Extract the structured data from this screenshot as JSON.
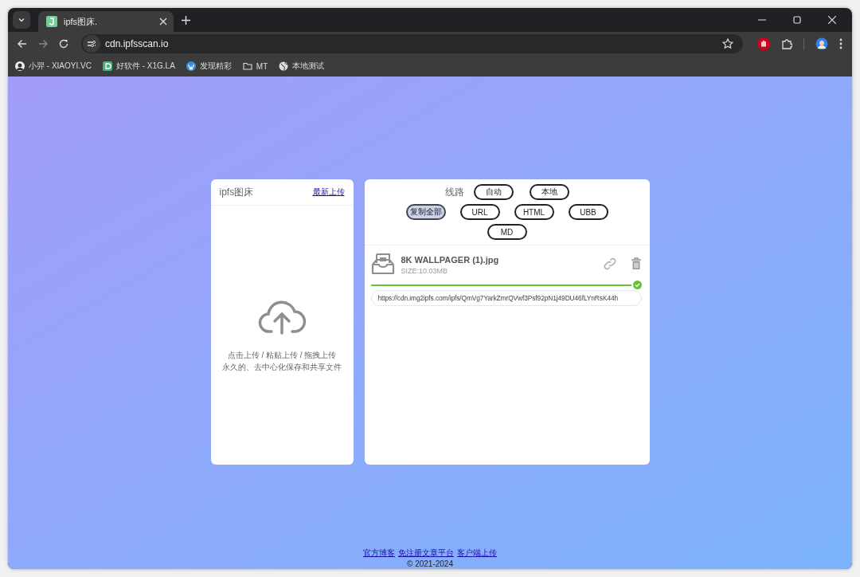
{
  "browser": {
    "tabs": [
      {
        "title": "ipfs图床.",
        "selected": true
      }
    ],
    "address": "cdn.ipfsscan.io",
    "bookmarks": [
      {
        "kind": "avatar",
        "label": "小羿 - XIAOYI.VC"
      },
      {
        "kind": "app",
        "label": "好软件 - X1G.LA"
      },
      {
        "kind": "wordpress",
        "label": "发现精彩"
      },
      {
        "kind": "folder",
        "label": "MT"
      },
      {
        "kind": "globe",
        "label": "本地测试"
      }
    ]
  },
  "upload_panel": {
    "title": "ipfs图床",
    "latest_link": "最新上传",
    "hint_lines": [
      "点击上传 / 粘贴上传 / 拖拽上传",
      "永久的、去中心化保存和共享文件"
    ]
  },
  "result_panel": {
    "route_label": "线路",
    "routes": [
      "自动",
      "本地"
    ],
    "formats": [
      {
        "label": "复制全部",
        "selected": true
      },
      {
        "label": "URL",
        "selected": false
      },
      {
        "label": "HTML",
        "selected": false
      },
      {
        "label": "UBB",
        "selected": false
      },
      {
        "label": "MD",
        "selected": false
      }
    ],
    "files": [
      {
        "name": "8K WALLPAGER (1).jpg",
        "size": "SIZE:10.03MB",
        "level": 1,
        "done": true,
        "url": "https://cdn.img2ipfs.com/ipfs/QmVg7YarkZmrQVwf3Psf92pN1j49DU46fLYnRsK44h"
      }
    ]
  },
  "footer": {
    "links": [
      "官方博客",
      "免注册文章平台",
      "客户端上传"
    ],
    "copyright": "© 2021-2024"
  }
}
